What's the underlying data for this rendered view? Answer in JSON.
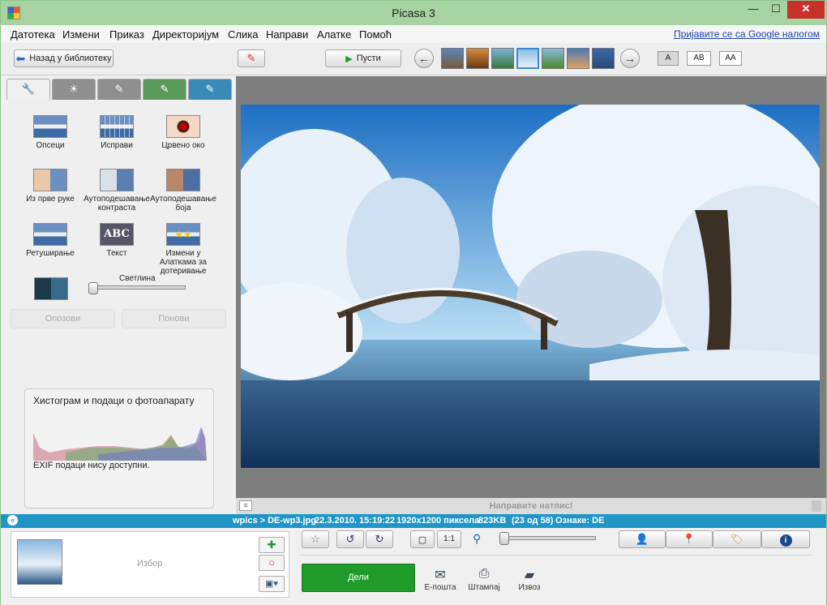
{
  "window": {
    "title": "Picasa 3",
    "min": "—",
    "max": "☐",
    "close": "✕"
  },
  "menu": [
    "Датотека",
    "Измени",
    "Приказ",
    "Директоријум",
    "Слика",
    "Направи",
    "Алатке",
    "Помоћ"
  ],
  "signin_link": "Пријавите се са Google налогом",
  "toolbar": {
    "back_label": "Назад у библиотеку",
    "play_label": "Пусти",
    "caption_modes": [
      "A",
      "AB",
      "AA"
    ]
  },
  "tabs": [
    "wrench-icon",
    "sun-icon",
    "brush-icon",
    "green-brush-icon",
    "blue-brush-icon"
  ],
  "tools": {
    "crop": "Опсеци",
    "straighten": "Исправи",
    "redeye": "Црвено око",
    "feeling_lucky": "Из прве руке",
    "auto_contrast": "Аутоподешавање контраста",
    "auto_color": "Аутоподешавање боја",
    "retouch": "Ретуширање",
    "text": "Текст",
    "text_thumb": "ABC",
    "edit_tools": "Измени у Алаткама за дотеривање",
    "brightness_label": "Светлина"
  },
  "undo_label": "Опозови",
  "redo_label": "Понови",
  "histogram": {
    "title": "Хистограм и подаци о фотоапарату",
    "exif": "EXIF подаци нису доступни."
  },
  "caption_placeholder": "Направите натпис!",
  "status": {
    "path": "wpics > DE-wp3.jpg",
    "date": "22.3.2010. 15:19:22",
    "dims": "1920x1200 пиксела",
    "size": "823KB",
    "index": "(23 од 58)",
    "tags": "Ознаке: DE"
  },
  "tray": {
    "label": "Избор"
  },
  "zoom": {
    "one_to_one": "1:1"
  },
  "actions": {
    "share": "Дели",
    "email": "Е-пошта",
    "print": "Штампај",
    "export": "Извоз"
  },
  "colors": {
    "title_bar": "#a6d3a1",
    "status_bar": "#1f96c6",
    "share_button": "#1f9b2a",
    "close_button": "#c8312a"
  }
}
